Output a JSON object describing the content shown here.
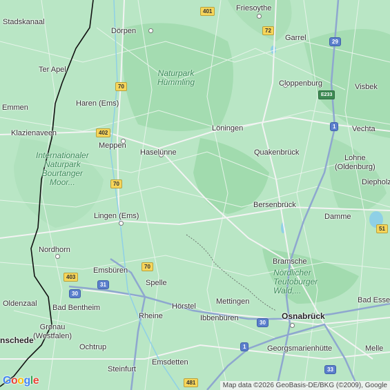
{
  "map": {
    "cities": [
      {
        "name": "Friesoythe",
        "size": "md"
      },
      {
        "name": "Stadskanaal",
        "size": "md"
      },
      {
        "name": "Dörpen",
        "size": "md"
      },
      {
        "name": "Garrel",
        "size": "md"
      },
      {
        "name": "Ter Apel",
        "size": "md"
      },
      {
        "name": "Cloppenburg",
        "size": "md"
      },
      {
        "name": "Visbek",
        "size": "md"
      },
      {
        "name": "Emmen",
        "size": "md"
      },
      {
        "name": "Haren (Ems)",
        "size": "md"
      },
      {
        "name": "Löningen",
        "size": "md"
      },
      {
        "name": "Vechta",
        "size": "md"
      },
      {
        "name": "Klazienaveen",
        "size": "md"
      },
      {
        "name": "Meppen",
        "size": "md"
      },
      {
        "name": "Haselünne",
        "size": "md"
      },
      {
        "name": "Quakenbrück",
        "size": "md"
      },
      {
        "name": "Lohne\n(Oldenburg)",
        "size": "md"
      },
      {
        "name": "Diepholz",
        "size": "md"
      },
      {
        "name": "Bersenbrück",
        "size": "md"
      },
      {
        "name": "Lingen (Ems)",
        "size": "md"
      },
      {
        "name": "Damme",
        "size": "md"
      },
      {
        "name": "Nordhorn",
        "size": "md"
      },
      {
        "name": "Bramsche",
        "size": "md"
      },
      {
        "name": "Emsbüren",
        "size": "md"
      },
      {
        "name": "Spelle",
        "size": "md"
      },
      {
        "name": "Oldenzaal",
        "size": "md"
      },
      {
        "name": "Bad Bentheim",
        "size": "md"
      },
      {
        "name": "Hörstel",
        "size": "md"
      },
      {
        "name": "Mettingen",
        "size": "md"
      },
      {
        "name": "Bad Essen",
        "size": "md"
      },
      {
        "name": "Rheine",
        "size": "md"
      },
      {
        "name": "Ibbenbüren",
        "size": "md"
      },
      {
        "name": "Osnabrück",
        "size": "lg"
      },
      {
        "name": "nschede",
        "size": "md"
      },
      {
        "name": "Gronau\n(Westfalen)",
        "size": "md"
      },
      {
        "name": "Ochtrup",
        "size": "md"
      },
      {
        "name": "Georgsmarienhütte",
        "size": "md"
      },
      {
        "name": "Melle",
        "size": "md"
      },
      {
        "name": "Steinfurt",
        "size": "md"
      },
      {
        "name": "Emsdetten",
        "size": "md"
      }
    ],
    "parks": [
      {
        "name": "Naturpark\nHümmling"
      },
      {
        "name": "Internationaler\nNaturpark\nBourtanger\nMoor..."
      },
      {
        "name": "Nördlicher\nTeutoburger\nWald,..."
      }
    ],
    "shields": [
      {
        "label": "401",
        "type": "B"
      },
      {
        "label": "72",
        "type": "B"
      },
      {
        "label": "29",
        "type": "A"
      },
      {
        "label": "70",
        "type": "B"
      },
      {
        "label": "E233",
        "type": "E"
      },
      {
        "label": "1",
        "type": "A"
      },
      {
        "label": "402",
        "type": "B"
      },
      {
        "label": "70",
        "type": "B"
      },
      {
        "label": "51",
        "type": "B"
      },
      {
        "label": "70",
        "type": "B"
      },
      {
        "label": "403",
        "type": "B"
      },
      {
        "label": "30",
        "type": "A"
      },
      {
        "label": "31",
        "type": "A"
      },
      {
        "label": "30",
        "type": "A"
      },
      {
        "label": "1",
        "type": "A"
      },
      {
        "label": "33",
        "type": "A"
      },
      {
        "label": "481",
        "type": "B"
      }
    ],
    "attribution": "Map data ©2026 GeoBasis-DE/BKG (©2009), Google",
    "logo": {
      "g1": "G",
      "o1": "o",
      "o2": "o",
      "g2": "g",
      "l": "l",
      "e": "e"
    },
    "colors": {
      "land": "#b9e6c5",
      "forest": "#9fd9ad",
      "highway": "#8ea7cf",
      "water": "#8fd0e6",
      "border": "#111111"
    }
  }
}
